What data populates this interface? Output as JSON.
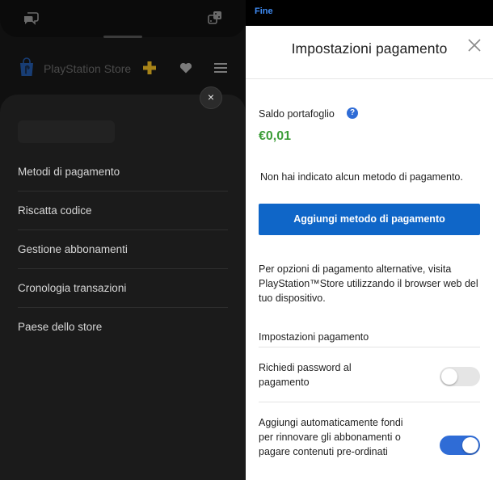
{
  "left": {
    "store_title": "PlayStation Store",
    "close_glyph": "×",
    "menu": [
      {
        "label": "Metodi di pagamento"
      },
      {
        "label": "Riscatta codice"
      },
      {
        "label": "Gestione abbonamenti"
      },
      {
        "label": "Cronologia transazioni"
      },
      {
        "label": "Paese dello store"
      }
    ],
    "icons": {
      "top_left": "chat-icon",
      "top_right": "dice-icon",
      "logo": "playstation-store-logo",
      "plus": "playstation-plus-icon",
      "wishlist": "heart-icon",
      "menu": "hamburger-menu-icon"
    }
  },
  "right": {
    "status_link": "Fine",
    "title": "Impostazioni pagamento",
    "wallet": {
      "label": "Saldo portafoglio",
      "help": "?",
      "balance": "€0,01"
    },
    "no_method": "Non hai indicato alcun metodo di pagamento.",
    "add_button": "Aggiungi metodo di pagamento",
    "alt_text": "Per opzioni di pagamento alternative, visita PlayStation™Store utilizzando il browser web del tuo dispositivo.",
    "section_title": "Impostazioni pagamento",
    "settings": [
      {
        "label": "Richiedi password al pagamento",
        "enabled": false
      },
      {
        "label": "Aggiungi automaticamente fondi per rinnovare gli abbonamenti o pagare contenuti pre-ordinati",
        "enabled": true
      }
    ]
  },
  "colors": {
    "accent_blue": "#0f66c8",
    "toggle_on": "#2f6cd6",
    "balance_green": "#3c9d38",
    "link_blue": "#3f8cf5",
    "ps_plus_yellow": "#d9a91b",
    "ps_store_blue": "#1f63c6"
  }
}
